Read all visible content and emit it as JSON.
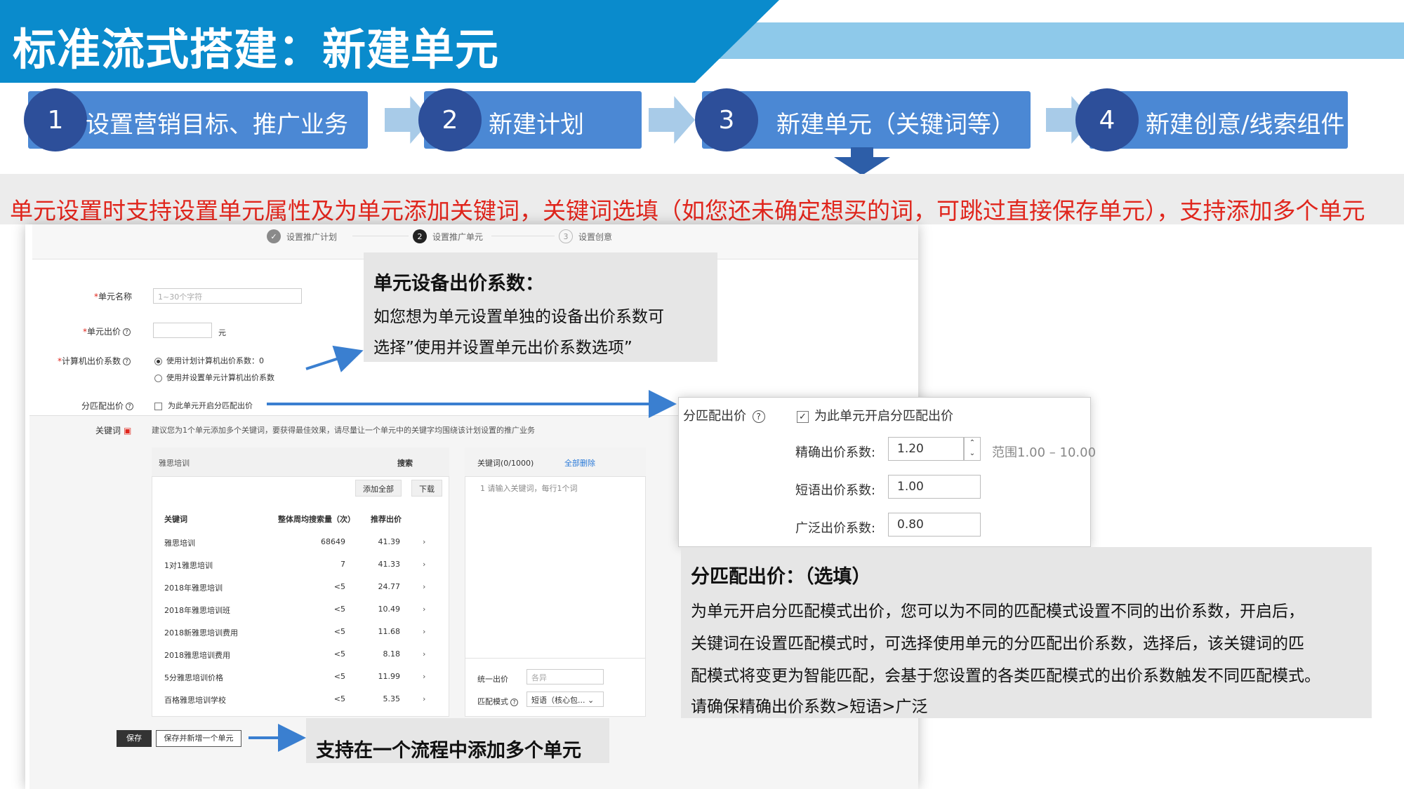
{
  "header": {
    "title": "标准流式搭建：新建单元"
  },
  "steps": [
    {
      "num": "1",
      "label": "设置营销目标、推广业务"
    },
    {
      "num": "2",
      "label": "新建计划"
    },
    {
      "num": "3",
      "label": "新建单元（关键词等）"
    },
    {
      "num": "4",
      "label": "新建创意/线索组件"
    }
  ],
  "banner": {
    "text": "单元设置时支持设置单元属性及为单元添加关键词，关键词选填（如您还未确定想买的词，可跳过直接保存单元），支持添加多个单元"
  },
  "progress": [
    {
      "num": "✓",
      "label": "设置推广计划"
    },
    {
      "num": "2",
      "label": "设置推广单元"
    },
    {
      "num": "3",
      "label": "设置创意"
    }
  ],
  "form": {
    "unit_name_label": "单元名称",
    "unit_name_placeholder": "1~30个字符",
    "unit_bid_label": "单元出价",
    "unit_bid_unit": "元",
    "pc_factor_label": "计算机出价系数",
    "pc_option_1": "使用计划计算机出价系数：0",
    "pc_option_2": "使用并设置单元计算机出价系数",
    "match_bid_label": "分匹配出价",
    "match_bid_checkbox": "为此单元开启分匹配出价",
    "keyword_label": "关键词",
    "keyword_hint": "建议您为1个单元添加多个关键词，要获得最佳效果，请尽量让一个单元中的关键字均围绕该计划设置的推广业务"
  },
  "keyword_search": {
    "query": "雅思培训",
    "search_button": "搜索",
    "add_all": "添加全部",
    "download": "下载",
    "col_keyword": "关键词",
    "col_volume": "整体周均搜索量（次）",
    "col_bid": "推荐出价",
    "rows": [
      {
        "kw": "雅思培训",
        "volume": "68649",
        "bid": "41.39"
      },
      {
        "kw": "1对1雅思培训",
        "volume": "7",
        "bid": "41.33"
      },
      {
        "kw": "2018年雅思培训",
        "volume": "<5",
        "bid": "24.77"
      },
      {
        "kw": "2018年雅思培训班",
        "volume": "<5",
        "bid": "10.49"
      },
      {
        "kw": "2018新雅思培训费用",
        "volume": "<5",
        "bid": "11.68"
      },
      {
        "kw": "2018雅思培训费用",
        "volume": "<5",
        "bid": "8.18"
      },
      {
        "kw": "5分雅思培训价格",
        "volume": "<5",
        "bid": "11.99"
      },
      {
        "kw": "百格雅思培训学校",
        "volume": "<5",
        "bid": "5.35"
      }
    ]
  },
  "keyword_list": {
    "header": "关键词(0/1000)",
    "delete_all": "全部删除",
    "placeholder": "1  请输入关键词，每行1个词",
    "unified_bid_label": "统一出价",
    "unified_bid_placeholder": "各异",
    "match_mode_label": "匹配模式",
    "match_mode_value": "短语（核心包...",
    "save": "保存",
    "save_new": "保存并新增一个单元"
  },
  "callout_device": {
    "title": "单元设备出价系数：",
    "line1": "如您想为单元设置单独的设备出价系数可",
    "line2": "选择”使用并设置单元出价系数选项”"
  },
  "popup": {
    "label": "分匹配出价",
    "checkbox": "为此单元开启分匹配出价",
    "exact_label": "精确出价系数:",
    "exact_value": "1.20",
    "range": "范围1.00 – 10.00",
    "phrase_label": "短语出价系数:",
    "phrase_value": "1.00",
    "broad_label": "广泛出价系数:",
    "broad_value": "0.80"
  },
  "callout_match": {
    "title": "分匹配出价：（选填）",
    "line1": "为单元开启分匹配模式出价，您可以为不同的匹配模式设置不同的出价系数，开启后，",
    "line2": "关键词在设置匹配模式时，可选择使用单元的分匹配出价系数，选择后，该关键词的匹",
    "line3": "配模式将变更为智能匹配，会基于您设置的各类匹配模式的出价系数触发不同匹配模式。",
    "line4": "请确保精确出价系数>短语>广泛"
  },
  "callout_multi": {
    "title": "支持在一个流程中添加多个单元"
  },
  "colors": {
    "header_blue": "#0a8bcc",
    "step_blue": "#4b88d4",
    "circle_navy": "#2d4f9a",
    "banner_red": "#e0261d",
    "arrow_blue": "#3a7fd0"
  }
}
